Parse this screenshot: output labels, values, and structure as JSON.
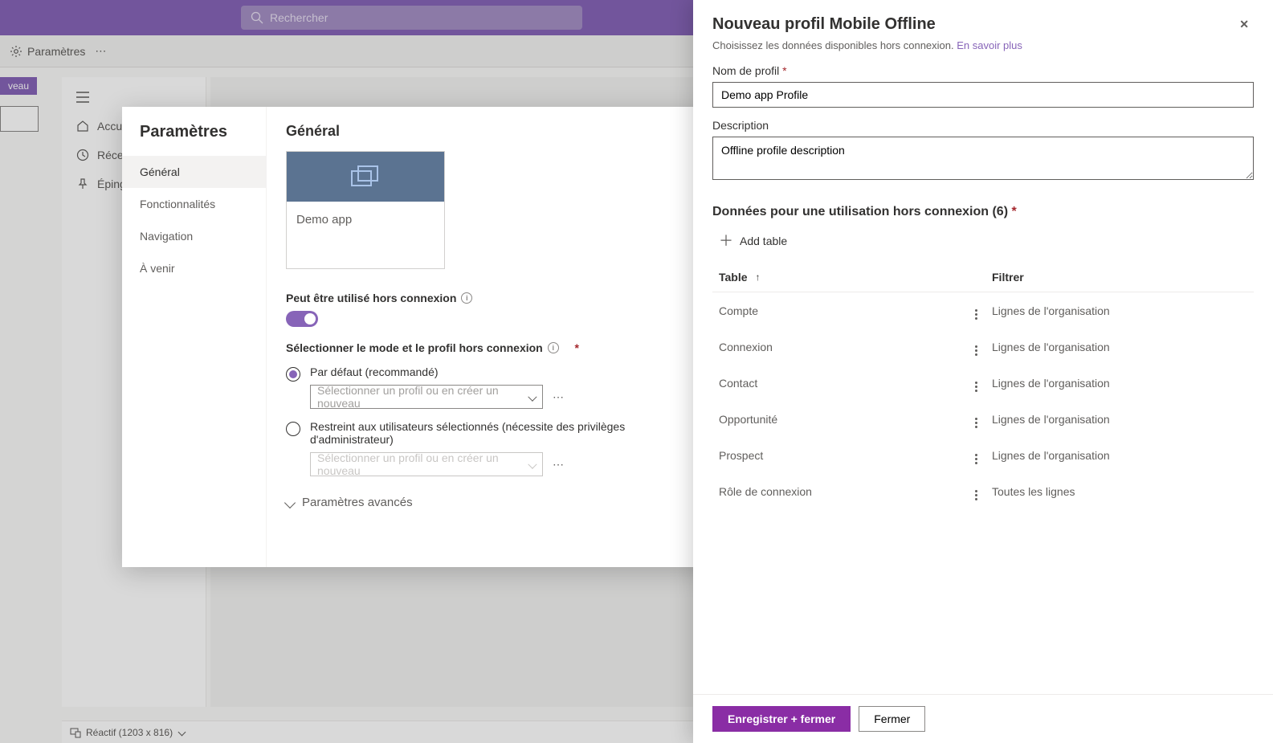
{
  "header": {
    "search_placeholder": "Rechercher"
  },
  "commandbar": {
    "settings": "Paramètres"
  },
  "leftnav": {
    "new_btn": "veau",
    "items": [
      {
        "label": "Accue"
      },
      {
        "label": "Récen"
      },
      {
        "label": "Éping"
      }
    ]
  },
  "settings_dialog": {
    "title": "Paramètres",
    "tabs": [
      {
        "label": "Général",
        "active": true
      },
      {
        "label": "Fonctionnalités"
      },
      {
        "label": "Navigation"
      },
      {
        "label": "À venir"
      }
    ],
    "content_title": "Général",
    "app_card": {
      "name": "Demo app"
    },
    "offline_toggle_label": "Peut être utilisé hors connexion",
    "mode_label": "Sélectionner le mode et le profil hors connexion",
    "modes": [
      {
        "label": "Par défaut (recommandé)",
        "placeholder": "Sélectionner un profil ou en créer un nouveau",
        "checked": true
      },
      {
        "label": "Restreint aux utilisateurs sélectionnés (nécessite des privilèges d'administrateur)",
        "placeholder": "Sélectionner un profil ou en créer un nouveau",
        "checked": false
      }
    ],
    "advanced": "Paramètres avancés"
  },
  "panel": {
    "title": "Nouveau profil Mobile Offline",
    "subtitle": "Choisissez les données disponibles hors connexion. ",
    "learn_more": "En savoir plus",
    "name_label": "Nom de profil",
    "name_value": "Demo app Profile",
    "desc_label": "Description",
    "desc_value": "Offline profile description",
    "data_section": "Données pour une utilisation hors connexion (6)",
    "add_table": "Add table",
    "columns": {
      "table": "Table",
      "filter": "Filtrer"
    },
    "rows": [
      {
        "name": "Compte",
        "filter": "Lignes de l'organisation"
      },
      {
        "name": "Connexion",
        "filter": "Lignes de l'organisation"
      },
      {
        "name": "Contact",
        "filter": "Lignes de l'organisation"
      },
      {
        "name": "Opportunité",
        "filter": "Lignes de l'organisation"
      },
      {
        "name": "Prospect",
        "filter": "Lignes de l'organisation"
      },
      {
        "name": "Rôle de connexion",
        "filter": "Toutes les lignes"
      }
    ],
    "save_close": "Enregistrer + fermer",
    "close": "Fermer"
  },
  "footer": {
    "reactif": "Réactif (1203 x 816)"
  }
}
